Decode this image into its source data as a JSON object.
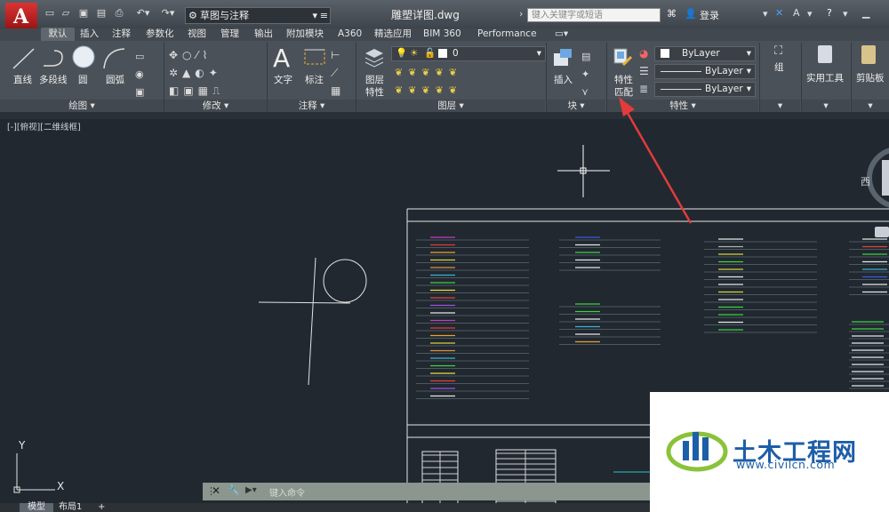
{
  "titlebar": {
    "workspace": "草图与注释",
    "document_title": "雕塑详图.dwg",
    "search_placeholder": "键入关键字或短语",
    "login": "登录"
  },
  "tabs": [
    "默认",
    "插入",
    "注释",
    "参数化",
    "视图",
    "管理",
    "输出",
    "附加模块",
    "A360",
    "精选应用",
    "BIM 360",
    "Performance"
  ],
  "ribbon": {
    "draw": {
      "title": "绘图",
      "tools": [
        "直线",
        "多段线",
        "圆",
        "圆弧"
      ]
    },
    "modify": {
      "title": "修改"
    },
    "annotation": {
      "title": "注释",
      "tools": [
        "文字",
        "标注"
      ]
    },
    "layers": {
      "title": "图层",
      "layer_props": [
        "图层",
        "特性"
      ],
      "current_layer": "0"
    },
    "block": {
      "title": "块",
      "insert": "插入"
    },
    "properties": {
      "title": "特性",
      "match": [
        "特性",
        "匹配"
      ],
      "color": "ByLayer",
      "linetype": "ByLayer",
      "lineweight": "ByLayer"
    },
    "group": {
      "label": "组"
    },
    "utilities": {
      "label": "实用工具"
    },
    "clipboard": {
      "label": "剪贴板"
    }
  },
  "viewport": {
    "label": "[-][俯视][二维线框]",
    "viewcube_west": "西"
  },
  "ucs": {
    "x": "X",
    "y": "Y"
  },
  "commandline": {
    "placeholder": "键入命令"
  },
  "layout_tabs": [
    "模型",
    "布局1",
    "+"
  ],
  "watermark": {
    "title": "土木工程网",
    "url": "www.civilcn.com"
  },
  "colors": {
    "accent": "#e23b3b",
    "background": "#212830",
    "ribbon": "#4b5158"
  }
}
